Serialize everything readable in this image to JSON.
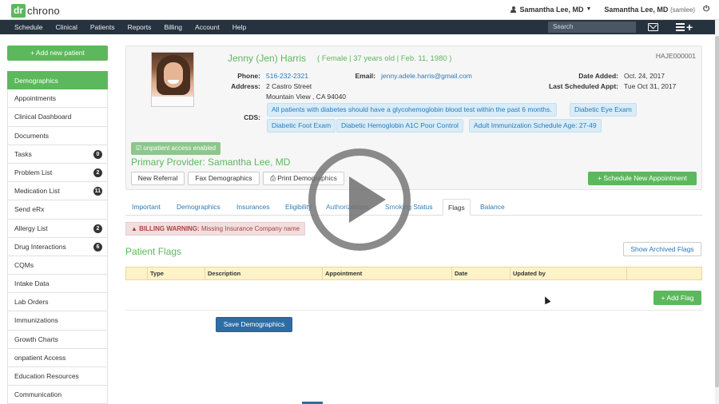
{
  "header": {
    "logo_prefix": "dr",
    "logo_suffix": "chrono",
    "user_name": "Samantha Lee, MD",
    "account_name": "Samantha Lee, MD",
    "account_username": "(samlee)"
  },
  "nav": {
    "items": [
      "Schedule",
      "Clinical",
      "Patients",
      "Reports",
      "Billing",
      "Account",
      "Help"
    ],
    "search_placeholder": "Search"
  },
  "sidebar": {
    "add_patient_label": "+ Add new patient",
    "items": [
      {
        "label": "Demographics",
        "badge": ""
      },
      {
        "label": "Appointments",
        "badge": ""
      },
      {
        "label": "Clinical Dashboard",
        "badge": ""
      },
      {
        "label": "Documents",
        "badge": ""
      },
      {
        "label": "Tasks",
        "badge": "0"
      },
      {
        "label": "Problem List",
        "badge": "2"
      },
      {
        "label": "Medication List",
        "badge": "11"
      },
      {
        "label": "Send eRx",
        "badge": ""
      },
      {
        "label": "Allergy List",
        "badge": "2"
      },
      {
        "label": "Drug Interactions",
        "badge": "6"
      },
      {
        "label": "CQMs",
        "badge": ""
      },
      {
        "label": "Intake Data",
        "badge": ""
      },
      {
        "label": "Lab Orders",
        "badge": ""
      },
      {
        "label": "Immunizations",
        "badge": ""
      },
      {
        "label": "Growth Charts",
        "badge": ""
      },
      {
        "label": "onpatient Access",
        "badge": ""
      },
      {
        "label": "Education Resources",
        "badge": ""
      },
      {
        "label": "Communication",
        "badge": ""
      }
    ]
  },
  "patient": {
    "name": "Jenny (Jen) Harris",
    "meta": "( Female | 37 years old | Feb. 11, 1980 )",
    "id": "HAJE000001",
    "phone_label": "Phone:",
    "phone": "516-232-2321",
    "email_label": "Email:",
    "email": "jenny.adele.harris@gmail.com",
    "address_label": "Address:",
    "address_line1": "2 Castro Street",
    "address_line2": "Mountain View , CA 94040",
    "date_added_label": "Date Added:",
    "date_added": "Oct. 24, 2017",
    "last_appt_label": "Last Scheduled Appt:",
    "last_appt": "Tue Oct 31, 2017",
    "cds_label": "CDS:",
    "cds_tags": [
      "All patients with diabetes should have a glycohemoglobin blood test within the past 6 months.",
      "Diabetic Eye Exam",
      "Diabetic Foot Exam",
      "Diabetic Hemoglobin A1C Poor Control",
      "Adult Immunization Schedule Age: 27-49"
    ],
    "access_label": "☑ onpatient access enabled",
    "primary_provider": "Primary Provider: Samantha Lee, MD",
    "new_referral": "New Referral",
    "fax_demographics": "Fax Demographics",
    "print_demographics": "Print Demographics",
    "schedule_new": "+ Schedule New Appointment"
  },
  "tabs": [
    "Important",
    "Demographics",
    "Insurances",
    "Eligibility",
    "Authorizations",
    "Smoking Status",
    "Flags",
    "Balance"
  ],
  "active_tab": "Flags",
  "warning": {
    "title": "BILLING WARNING:",
    "text": "Missing Insurance Company name"
  },
  "flags": {
    "title": "Patient Flags",
    "show_archived": "Show Archived Flags",
    "columns": [
      "Type",
      "Description",
      "Appointment",
      "Date",
      "Updated by"
    ],
    "add_flag": "+ Add Flag"
  },
  "save_demographics": "Save Demographics",
  "colors": {
    "brand_green": "#5cb85c",
    "nav_dark": "#27323f",
    "link_blue": "#2a7ab8",
    "primary_button": "#2e6da4"
  }
}
